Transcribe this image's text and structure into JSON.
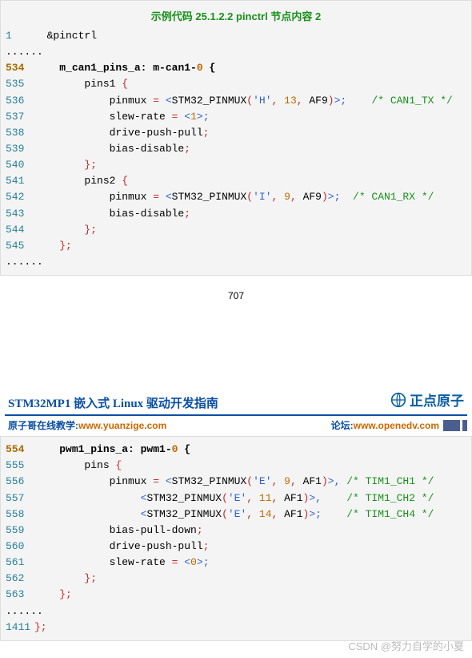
{
  "block1": {
    "title": "示例代码 25.1.2.2 pinctrl 节点内容 2",
    "lines": [
      {
        "num": "1",
        "content": "  &pinctrl"
      },
      {
        "dots": "......"
      },
      {
        "num": "534",
        "bold": true,
        "parts": [
          {
            "t": "    "
          },
          {
            "t": "m_can1_pins_a: m-can1-",
            "cls": "kw-bold"
          },
          {
            "t": "0",
            "cls": "orange kw-bold"
          },
          {
            "t": " {",
            "cls": "kw-bold"
          }
        ]
      },
      {
        "num": "535",
        "parts": [
          {
            "t": "        pins1 "
          },
          {
            "t": "{",
            "cls": "red"
          }
        ]
      },
      {
        "num": "536",
        "parts": [
          {
            "t": "            pinmux "
          },
          {
            "t": "=",
            "cls": "red"
          },
          {
            "t": " "
          },
          {
            "t": "<",
            "cls": "blue"
          },
          {
            "t": "STM32_PINMUX"
          },
          {
            "t": "(",
            "cls": "red"
          },
          {
            "t": "'H'",
            "cls": "blue"
          },
          {
            "t": ",",
            "cls": "red"
          },
          {
            "t": " "
          },
          {
            "t": "13",
            "cls": "orange"
          },
          {
            "t": ",",
            "cls": "red"
          },
          {
            "t": " AF9"
          },
          {
            "t": ")",
            "cls": "red"
          },
          {
            "t": ">;",
            "cls": "blue"
          },
          {
            "t": "    "
          },
          {
            "t": "/* CAN1_TX */",
            "cls": "green"
          }
        ]
      },
      {
        "num": "537",
        "parts": [
          {
            "t": "            slew-rate "
          },
          {
            "t": "=",
            "cls": "red"
          },
          {
            "t": " "
          },
          {
            "t": "<",
            "cls": "blue"
          },
          {
            "t": "1",
            "cls": "orange"
          },
          {
            "t": ">;",
            "cls": "blue"
          }
        ]
      },
      {
        "num": "538",
        "parts": [
          {
            "t": "            drive-push-pull"
          },
          {
            "t": ";",
            "cls": "red"
          }
        ]
      },
      {
        "num": "539",
        "parts": [
          {
            "t": "            bias-disable"
          },
          {
            "t": ";",
            "cls": "red"
          }
        ]
      },
      {
        "num": "540",
        "parts": [
          {
            "t": "        "
          },
          {
            "t": "};",
            "cls": "red"
          }
        ]
      },
      {
        "num": "541",
        "parts": [
          {
            "t": "        pins2 "
          },
          {
            "t": "{",
            "cls": "red"
          }
        ]
      },
      {
        "num": "542",
        "parts": [
          {
            "t": "            pinmux "
          },
          {
            "t": "=",
            "cls": "red"
          },
          {
            "t": " "
          },
          {
            "t": "<",
            "cls": "blue"
          },
          {
            "t": "STM32_PINMUX"
          },
          {
            "t": "(",
            "cls": "red"
          },
          {
            "t": "'I'",
            "cls": "blue"
          },
          {
            "t": ",",
            "cls": "red"
          },
          {
            "t": " "
          },
          {
            "t": "9",
            "cls": "orange"
          },
          {
            "t": ",",
            "cls": "red"
          },
          {
            "t": " AF9"
          },
          {
            "t": ")",
            "cls": "red"
          },
          {
            "t": ">;",
            "cls": "blue"
          },
          {
            "t": "  "
          },
          {
            "t": "/* CAN1_RX */",
            "cls": "green"
          }
        ]
      },
      {
        "num": "543",
        "parts": [
          {
            "t": "            bias-disable"
          },
          {
            "t": ";",
            "cls": "red"
          }
        ]
      },
      {
        "num": "544",
        "parts": [
          {
            "t": "        "
          },
          {
            "t": "};",
            "cls": "red"
          }
        ]
      },
      {
        "num": "545",
        "parts": [
          {
            "t": "    "
          },
          {
            "t": "};",
            "cls": "red"
          }
        ]
      },
      {
        "dots": "......"
      }
    ]
  },
  "pageNumber": "707",
  "docHeader": {
    "title": "STM32MP1 嵌入式 Linux 驱动开发指南",
    "logoText": "正点原子",
    "leftLabel": "原子哥在线教学:",
    "leftUrl": "www.yuanzige.com",
    "rightLabel": "论坛:",
    "rightUrl": "www.openedv.com"
  },
  "block2": {
    "lines": [
      {
        "num": "554",
        "bold": true,
        "parts": [
          {
            "t": "    "
          },
          {
            "t": "pwm1_pins_a: pwm1-",
            "cls": "kw-bold"
          },
          {
            "t": "0",
            "cls": "orange kw-bold"
          },
          {
            "t": " {",
            "cls": "kw-bold"
          }
        ]
      },
      {
        "num": "555",
        "parts": [
          {
            "t": "        pins "
          },
          {
            "t": "{",
            "cls": "red"
          }
        ]
      },
      {
        "num": "556",
        "parts": [
          {
            "t": "            pinmux "
          },
          {
            "t": "=",
            "cls": "red"
          },
          {
            "t": " "
          },
          {
            "t": "<",
            "cls": "blue"
          },
          {
            "t": "STM32_PINMUX"
          },
          {
            "t": "(",
            "cls": "red"
          },
          {
            "t": "'E'",
            "cls": "blue"
          },
          {
            "t": ",",
            "cls": "red"
          },
          {
            "t": " "
          },
          {
            "t": "9",
            "cls": "orange"
          },
          {
            "t": ",",
            "cls": "red"
          },
          {
            "t": " AF1"
          },
          {
            "t": ")",
            "cls": "red"
          },
          {
            "t": ">,",
            "cls": "blue"
          },
          {
            "t": " "
          },
          {
            "t": "/* TIM1_CH1 */",
            "cls": "green"
          }
        ]
      },
      {
        "num": "557",
        "parts": [
          {
            "t": "                 "
          },
          {
            "t": "<",
            "cls": "blue"
          },
          {
            "t": "STM32_PINMUX"
          },
          {
            "t": "(",
            "cls": "red"
          },
          {
            "t": "'E'",
            "cls": "blue"
          },
          {
            "t": ",",
            "cls": "red"
          },
          {
            "t": " "
          },
          {
            "t": "11",
            "cls": "orange"
          },
          {
            "t": ",",
            "cls": "red"
          },
          {
            "t": " AF1"
          },
          {
            "t": ")",
            "cls": "red"
          },
          {
            "t": ">,",
            "cls": "blue"
          },
          {
            "t": "    "
          },
          {
            "t": "/* TIM1_CH2 */",
            "cls": "green"
          }
        ]
      },
      {
        "num": "558",
        "parts": [
          {
            "t": "                 "
          },
          {
            "t": "<",
            "cls": "blue"
          },
          {
            "t": "STM32_PINMUX"
          },
          {
            "t": "(",
            "cls": "red"
          },
          {
            "t": "'E'",
            "cls": "blue"
          },
          {
            "t": ",",
            "cls": "red"
          },
          {
            "t": " "
          },
          {
            "t": "14",
            "cls": "orange"
          },
          {
            "t": ",",
            "cls": "red"
          },
          {
            "t": " AF1"
          },
          {
            "t": ")",
            "cls": "red"
          },
          {
            "t": ">;",
            "cls": "blue"
          },
          {
            "t": "    "
          },
          {
            "t": "/* TIM1_CH4 */",
            "cls": "green"
          }
        ]
      },
      {
        "num": "559",
        "parts": [
          {
            "t": "            bias-pull-down"
          },
          {
            "t": ";",
            "cls": "red"
          }
        ]
      },
      {
        "num": "560",
        "parts": [
          {
            "t": "            drive-push-pull"
          },
          {
            "t": ";",
            "cls": "red"
          }
        ]
      },
      {
        "num": "561",
        "parts": [
          {
            "t": "            slew-rate "
          },
          {
            "t": "=",
            "cls": "red"
          },
          {
            "t": " "
          },
          {
            "t": "<",
            "cls": "blue"
          },
          {
            "t": "0",
            "cls": "orange"
          },
          {
            "t": ">;",
            "cls": "blue"
          }
        ]
      },
      {
        "num": "562",
        "parts": [
          {
            "t": "        "
          },
          {
            "t": "};",
            "cls": "red"
          }
        ]
      },
      {
        "num": "563",
        "parts": [
          {
            "t": "    "
          },
          {
            "t": "};",
            "cls": "red"
          }
        ]
      },
      {
        "dots": "......"
      },
      {
        "num": "1411",
        "parts": [
          {
            "t": "};",
            "cls": "red"
          }
        ]
      }
    ]
  },
  "watermark": "CSDN @努力自学的小夏"
}
